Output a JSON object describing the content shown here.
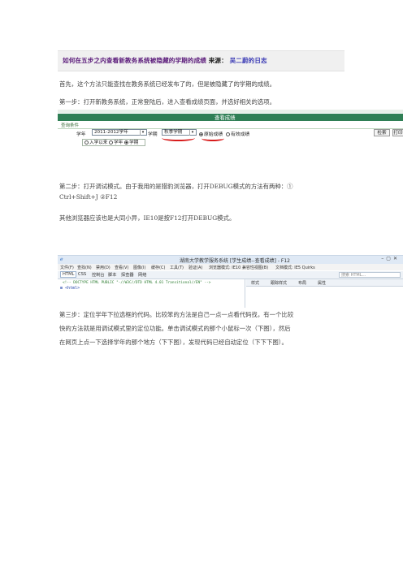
{
  "article": {
    "title": "如何在五步之内查看新教务系统被隐藏的学期的成绩",
    "source_label": "来源：",
    "source_link": "吴二蔚的日志"
  },
  "paragraphs": {
    "intro": "首先，这个方法只能查找在教务系统已经发布了的，但是被隐藏了的学期的成绩。",
    "step1": "第一步：打开新教务系统，正常登陆后，进入查看成绩页面，并选好相关的选项。",
    "step2_a": "第二步：打开调试模式。由于我用的是猎豹浏览器，打开DEBUG模式的方法有两种：①",
    "step2_b": "Ctrl+Shift+J ②F12",
    "step2_c": "其他浏览器应该也是大同小异，IE10是按F12打开DEBUG模式。",
    "step3_a": "第三步：定位学年下拉选框的代码。比较笨的方法是自己一点一点看代码找，有一个比较",
    "step3_b": "快的方法就是用调试模式里的定位功能。单击调试模式的那个小鼠标一次（下图），然后",
    "step3_c": "在网页上点一下选择学年的那个地方（下下图），发现代码已经自动定位（下下下图）。"
  },
  "screenshot1": {
    "header": "查看成绩",
    "subheader": "查询条件",
    "year_label": "学年",
    "year_value": "2011-2012学年",
    "term_label": "学期",
    "term_value": "秋季学期",
    "opt_original": "原始成绩",
    "opt_valid": "有效成绩",
    "row2_opt1": "入学以来",
    "row2_opt2": "学年",
    "row2_opt3": "学期",
    "btn_search": "检索",
    "btn_print": "打印"
  },
  "screenshot2": {
    "window_title": "湖南大学教学服务系统 [学生成绩--查看成绩] - F12",
    "menu": [
      "文件(F)",
      "查找(N)",
      "禁用(D)",
      "查看(V)",
      "图像(I)",
      "缓存(C)",
      "工具(T)",
      "验证(A)",
      "浏览器模式: IE10 兼容性视图(B)",
      "文档模式: IE5 Quirks"
    ],
    "tabs": [
      "HTML",
      "CSS",
      "控制台",
      "脚本",
      "探查器",
      "网络"
    ],
    "search_placeholder": "搜索 HTML...",
    "code_line1": "<!-- DOCTYPE HTML PUBLIC \"-//W3C//DTD HTML 4.01 Transitional//EN\" -->",
    "code_line2": "⊞ <html>",
    "right_tabs": [
      "样式",
      "跟踪样式",
      "布局",
      "属性"
    ]
  }
}
